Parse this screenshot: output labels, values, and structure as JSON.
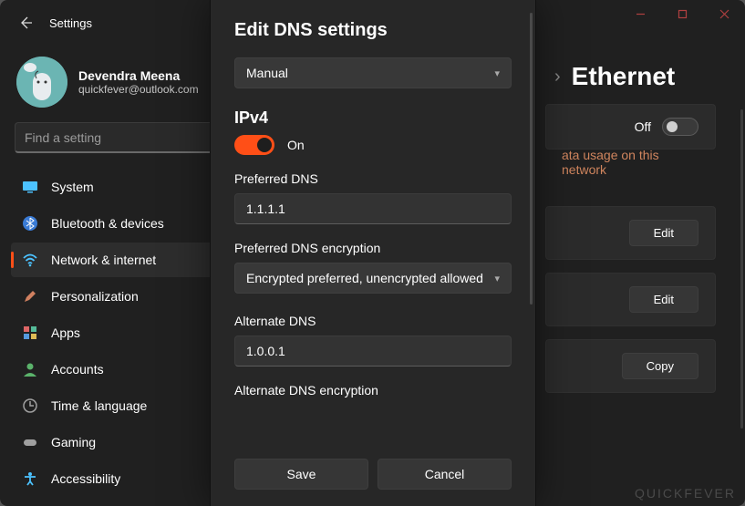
{
  "window": {
    "title": "Settings"
  },
  "profile": {
    "name": "Devendra Meena",
    "email": "quickfever@outlook.com"
  },
  "search": {
    "placeholder": "Find a setting"
  },
  "nav": {
    "items": [
      {
        "label": "System",
        "icon": "monitor-icon",
        "color": "#4cc2ff"
      },
      {
        "label": "Bluetooth & devices",
        "icon": "bluetooth-icon",
        "color": "#4cc2ff"
      },
      {
        "label": "Network & internet",
        "icon": "wifi-icon",
        "color": "#4cc2ff",
        "active": true
      },
      {
        "label": "Personalization",
        "icon": "paintbrush-icon",
        "color": "#d08060"
      },
      {
        "label": "Apps",
        "icon": "apps-icon",
        "color": "#d66"
      },
      {
        "label": "Accounts",
        "icon": "person-icon",
        "color": "#5bb36b"
      },
      {
        "label": "Time & language",
        "icon": "clock-globe-icon",
        "color": "#a0a0a0"
      },
      {
        "label": "Gaming",
        "icon": "gamepad-icon",
        "color": "#a0a0a0"
      },
      {
        "label": "Accessibility",
        "icon": "accessibility-icon",
        "color": "#4cc2ff"
      }
    ]
  },
  "breadcrumb": {
    "page": "Ethernet"
  },
  "main_rows": {
    "metered_toggle": {
      "label": "Off"
    },
    "warn_link": "ata usage on this network",
    "edit1": "Edit",
    "edit2": "Edit",
    "copy": "Copy"
  },
  "modal": {
    "title": "Edit DNS settings",
    "mode": "Manual",
    "section": "IPv4",
    "toggle_label": "On",
    "pref_dns_label": "Preferred DNS",
    "pref_dns_value": "1.1.1.1",
    "pref_enc_label": "Preferred DNS encryption",
    "pref_enc_value": "Encrypted preferred, unencrypted allowed",
    "alt_dns_label": "Alternate DNS",
    "alt_dns_value": "1.0.0.1",
    "alt_enc_label": "Alternate DNS encryption",
    "save": "Save",
    "cancel": "Cancel"
  },
  "watermark": "QUICKFEVER"
}
